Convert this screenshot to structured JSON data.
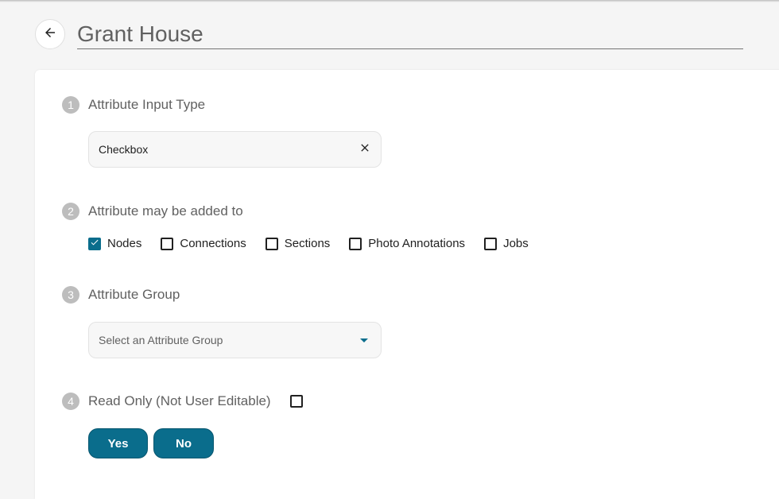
{
  "header": {
    "title": "Grant House"
  },
  "steps": [
    {
      "num": "1",
      "label": "Attribute Input Type"
    },
    {
      "num": "2",
      "label": "Attribute may be added to"
    },
    {
      "num": "3",
      "label": "Attribute Group"
    },
    {
      "num": "4",
      "label": "Read Only (Not User Editable)"
    }
  ],
  "input_type": {
    "value": "Checkbox"
  },
  "added_to": [
    {
      "label": "Nodes",
      "checked": true
    },
    {
      "label": "Connections",
      "checked": false
    },
    {
      "label": "Sections",
      "checked": false
    },
    {
      "label": "Photo Annotations",
      "checked": false
    },
    {
      "label": "Jobs",
      "checked": false
    }
  ],
  "attribute_group": {
    "placeholder": "Select an Attribute Group"
  },
  "read_only": {
    "checked": false
  },
  "buttons": {
    "yes": "Yes",
    "no": "No"
  },
  "colors": {
    "accent": "#0a6d8c",
    "step_badge": "#bdbdbd"
  },
  "icons": {
    "back": "arrow-left-icon",
    "clear": "close-icon",
    "dropdown": "caret-down-icon",
    "check": "check-icon"
  }
}
